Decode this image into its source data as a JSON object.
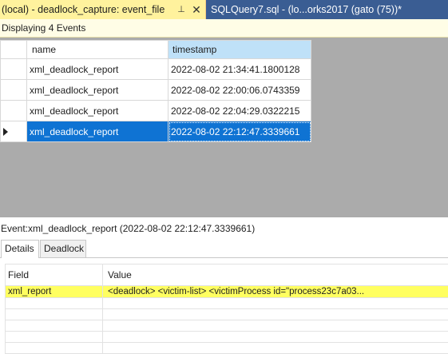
{
  "tabs": {
    "active": {
      "title": "(local) - deadlock_capture: event_file"
    },
    "inactive": {
      "title": "SQLQuery7.sql - (lo...orks2017 (gato (75))*"
    },
    "pin_glyph": "⊥",
    "close_glyph": "✕"
  },
  "infobar": {
    "text": "Displaying 4 Events"
  },
  "events_grid": {
    "columns": [
      "name",
      "timestamp"
    ],
    "sorted_column": "timestamp",
    "rows": [
      {
        "name": "xml_deadlock_report",
        "timestamp": "2022-08-02 21:34:41.1800128",
        "selected": false
      },
      {
        "name": "xml_deadlock_report",
        "timestamp": "2022-08-02 22:00:06.0743359",
        "selected": false
      },
      {
        "name": "xml_deadlock_report",
        "timestamp": "2022-08-02 22:04:29.0322215",
        "selected": false
      },
      {
        "name": "xml_deadlock_report",
        "timestamp": "2022-08-02 22:12:47.3339661",
        "selected": true
      }
    ]
  },
  "details": {
    "title": "Event:xml_deadlock_report (2022-08-02 22:12:47.3339661)",
    "tabs": [
      "Details",
      "Deadlock"
    ],
    "active_tab": "Details",
    "columns": [
      "Field",
      "Value"
    ],
    "rows": [
      {
        "field": "xml_report",
        "value": "<deadlock>  <victim-list>   <victimProcess id=\"process23c7a03...",
        "highlighted": true
      }
    ]
  },
  "colors": {
    "active_tab_bg": "#fff29d",
    "inactive_tab_bg": "#3a5d93",
    "selection": "#0f73d3",
    "highlight": "#ffff60",
    "grid_background": "#ababab"
  }
}
